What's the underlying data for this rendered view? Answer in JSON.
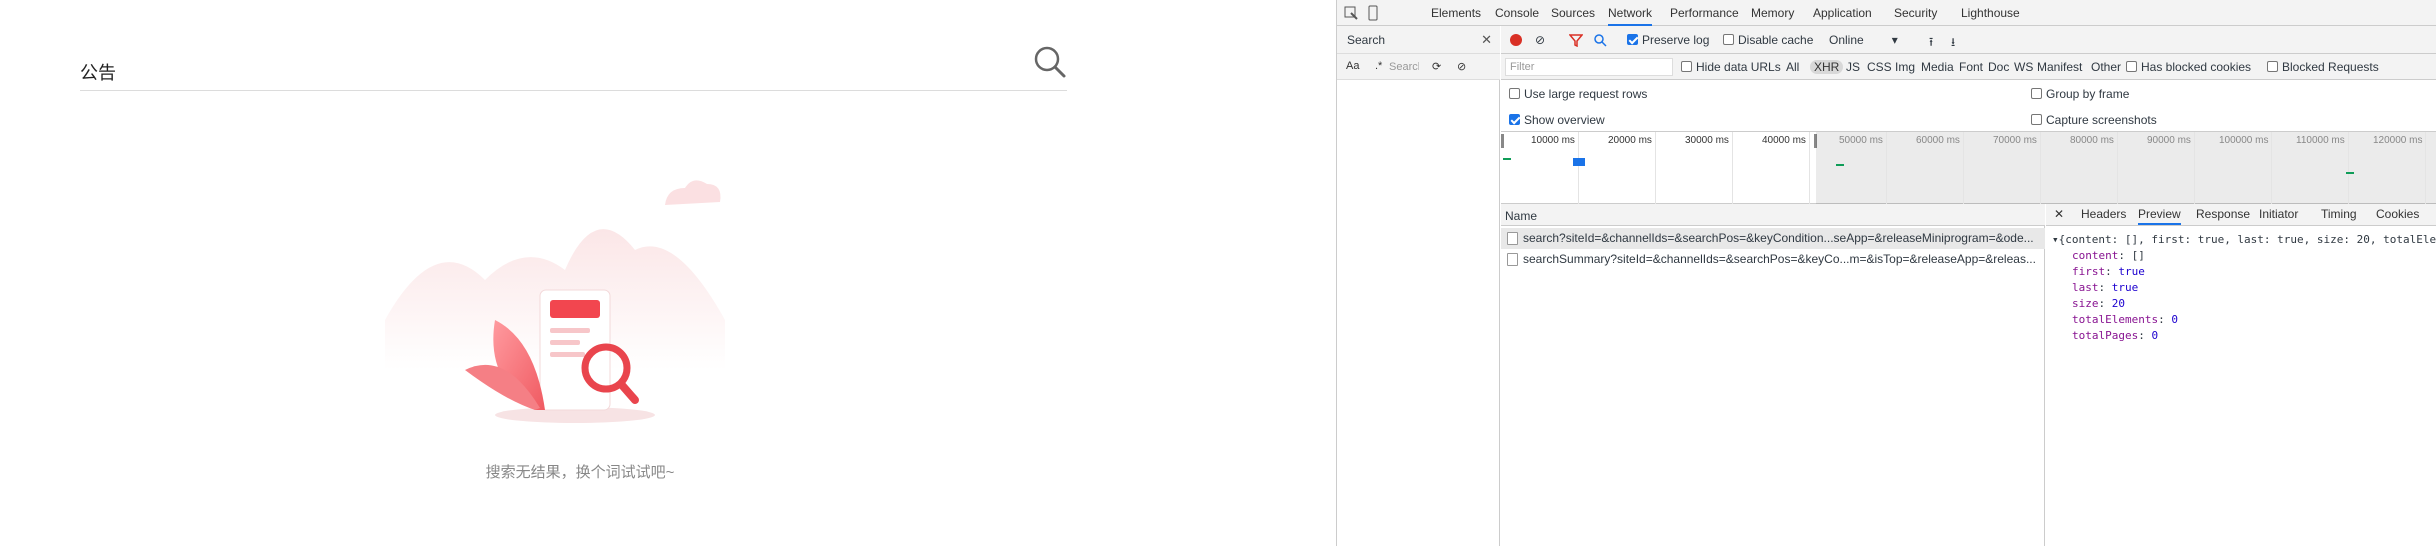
{
  "app": {
    "search_query": "公告",
    "empty_text": "搜索无结果，换个词试试吧~"
  },
  "devtools": {
    "tabs": [
      "Elements",
      "Console",
      "Sources",
      "Network",
      "Performance",
      "Memory",
      "Application",
      "Security",
      "Lighthouse"
    ],
    "active_tab": "Network",
    "search_panel": {
      "title": "Search",
      "case_label": "Aa",
      "regex_label": ".*",
      "placeholder": "Search"
    },
    "toolbar": {
      "preserve_log": "Preserve log",
      "disable_cache": "Disable cache",
      "throttling": "Online"
    },
    "filter": {
      "placeholder": "Filter",
      "hide_data_urls": "Hide data URLs",
      "types": [
        "All",
        "XHR",
        "JS",
        "CSS",
        "Img",
        "Media",
        "Font",
        "Doc",
        "WS",
        "Manifest",
        "Other"
      ],
      "active_type": "XHR",
      "has_blocked_cookies": "Has blocked cookies",
      "blocked_requests": "Blocked Requests"
    },
    "options": {
      "large_rows": "Use large request rows",
      "group_by_frame": "Group by frame",
      "show_overview": "Show overview",
      "capture_screenshots": "Capture screenshots"
    },
    "overview_ticks": [
      "10000 ms",
      "20000 ms",
      "30000 ms",
      "40000 ms",
      "50000 ms",
      "60000 ms",
      "70000 ms",
      "80000 ms",
      "90000 ms",
      "100000 ms",
      "110000 ms",
      "120000 ms"
    ],
    "list_header": "Name",
    "requests": [
      "search?siteId=&channelIds=&searchPos=&keyCondition...seApp=&releaseMiniprogram=&ode...",
      "searchSummary?siteId=&channelIds=&searchPos=&keyCo...m=&isTop=&releaseApp=&releas..."
    ],
    "detail_tabs": [
      "Headers",
      "Preview",
      "Response",
      "Initiator",
      "Timing",
      "Cookies"
    ],
    "active_detail_tab": "Preview",
    "preview": {
      "summary": "{content: [], first: true, last: true, size: 20, totalEle",
      "lines": [
        {
          "key": "content",
          "value": "[]"
        },
        {
          "key": "first",
          "value": "true"
        },
        {
          "key": "last",
          "value": "true"
        },
        {
          "key": "size",
          "value": "20"
        },
        {
          "key": "totalElements",
          "value": "0"
        },
        {
          "key": "totalPages",
          "value": "0"
        }
      ]
    }
  }
}
